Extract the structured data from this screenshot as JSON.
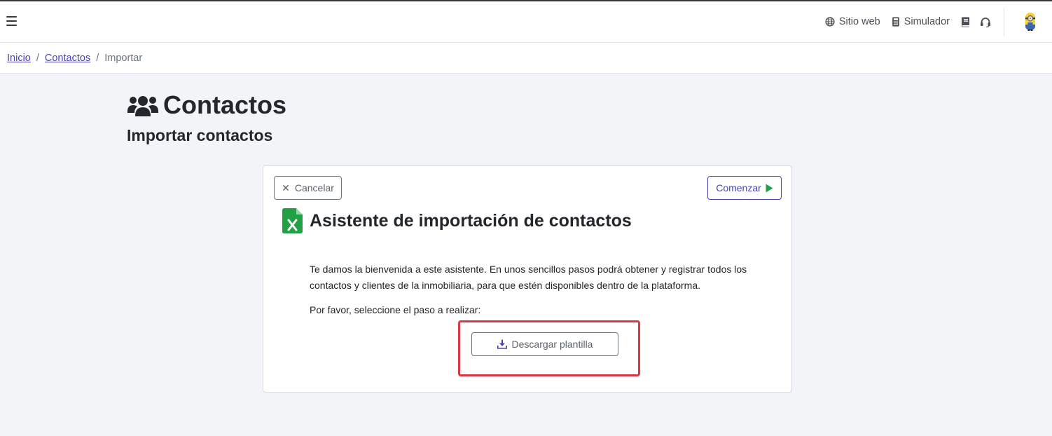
{
  "navbar": {
    "links": [
      {
        "label": "Sitio web",
        "icon": "globe-icon"
      },
      {
        "label": "Simulador",
        "icon": "calculator-icon"
      }
    ],
    "icons": [
      "book-icon",
      "headset-icon",
      "user-avatar-icon"
    ]
  },
  "breadcrumb": {
    "items": [
      "Inicio",
      "Contactos"
    ],
    "current": "Importar"
  },
  "page": {
    "title": "Contactos",
    "subtitle": "Importar contactos"
  },
  "wizard": {
    "cancel_label": "Cancelar",
    "start_label": "Comenzar",
    "title": "Asistente de importación de contactos",
    "intro": "Te damos la bienvenida a este asistente. En unos sencillos pasos podrá obtener y registrar todos los contactos y clientes de la inmobiliaria, para que estén disponibles dentro de la plataforma.",
    "prompt": "Por favor, seleccione el paso a realizar:",
    "download_label": "Descargar plantilla"
  },
  "colors": {
    "accent": "#4a44b8",
    "success": "#22a046",
    "highlight": "#dc3545"
  }
}
